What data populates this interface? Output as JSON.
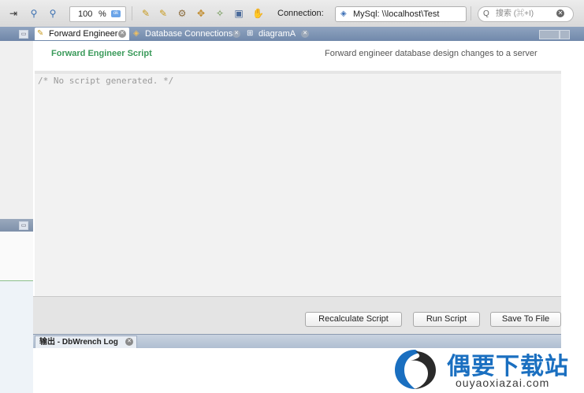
{
  "toolbar": {
    "zoom_value": "100",
    "zoom_unit": "%",
    "zoom_ok": "ok",
    "connection_label": "Connection:",
    "connection_value": "MySql: \\\\localhost\\Test",
    "search_placeholder": "搜索 (⌘+I)"
  },
  "tabs": [
    {
      "label": "Forward Engineer",
      "active": true
    },
    {
      "label": "Database Connections",
      "active": false
    },
    {
      "label": "diagramA",
      "active": false
    }
  ],
  "forward_engineer": {
    "title": "Forward Engineer Script",
    "description": "Forward engineer database design changes to a server",
    "script_text": "/* No script generated. */",
    "buttons": {
      "recalculate": "Recalculate Script",
      "run": "Run Script",
      "save": "Save To File"
    }
  },
  "log": {
    "tab_label": "输出 - DbWrench Log"
  },
  "watermark": {
    "title": "偶要下载站",
    "url": "ouyaoxiazai.com"
  },
  "colors": {
    "accent_green": "#3a9a5a",
    "tab_bar": "#7f96b6",
    "watermark_blue": "#1a6fc0"
  }
}
